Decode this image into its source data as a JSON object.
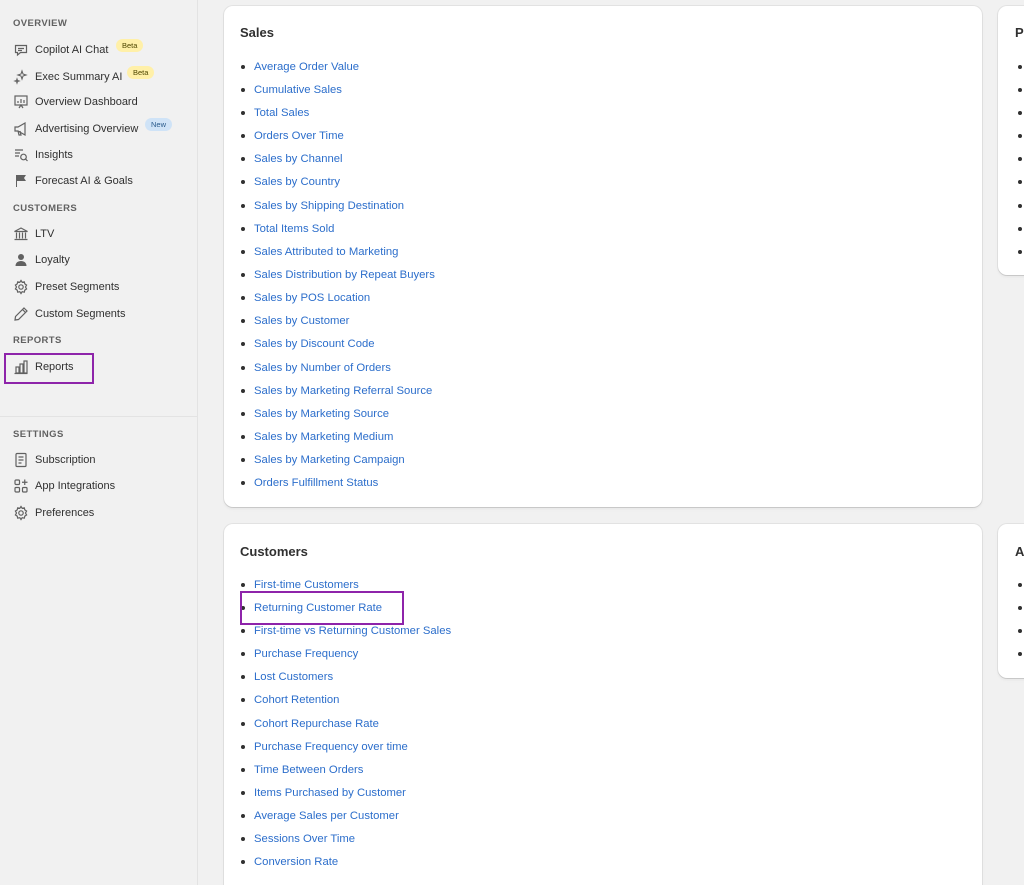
{
  "sidebar": {
    "sections": {
      "overview": "OVERVIEW",
      "customers": "CUSTOMERS",
      "reports": "REPORTS",
      "settings": "SETTINGS"
    },
    "items": {
      "copilot": {
        "label": "Copilot AI Chat",
        "badge": "Beta",
        "icon": "chat-bubble-icon"
      },
      "exec": {
        "label": "Exec Summary AI",
        "badge": "Beta",
        "icon": "sparkle-icon"
      },
      "overview_dashboard": {
        "label": "Overview Dashboard",
        "icon": "dashboard-icon"
      },
      "advertising": {
        "label": "Advertising Overview",
        "badge": "New",
        "icon": "megaphone-icon"
      },
      "insights": {
        "label": "Insights",
        "icon": "search-lines-icon"
      },
      "forecast": {
        "label": "Forecast AI & Goals",
        "icon": "flag-icon"
      },
      "ltv": {
        "label": "LTV",
        "icon": "bank-icon"
      },
      "loyalty": {
        "label": "Loyalty",
        "icon": "person-icon"
      },
      "preset": {
        "label": "Preset Segments",
        "icon": "gear-icon"
      },
      "custom": {
        "label": "Custom Segments",
        "icon": "pencil-icon"
      },
      "reports": {
        "label": "Reports",
        "icon": "bar-chart-icon"
      },
      "subscription": {
        "label": "Subscription",
        "icon": "receipt-icon"
      },
      "integrations": {
        "label": "App Integrations",
        "icon": "apps-icon"
      },
      "preferences": {
        "label": "Preferences",
        "icon": "gear-icon"
      }
    }
  },
  "main": {
    "sales": {
      "title": "Sales",
      "links": [
        "Average Order Value",
        "Cumulative Sales",
        "Total Sales",
        "Orders Over Time",
        "Sales by Channel",
        "Sales by Country",
        "Sales by Shipping Destination",
        "Total Items Sold",
        "Sales Attributed to Marketing",
        "Sales Distribution by Repeat Buyers",
        "Sales by POS Location",
        "Sales by Customer",
        "Sales by Discount Code",
        "Sales by Number of Orders",
        "Sales by Marketing Referral Source",
        "Sales by Marketing Source",
        "Sales by Marketing Medium",
        "Sales by Marketing Campaign",
        "Orders Fulfillment Status"
      ]
    },
    "customers": {
      "title": "Customers",
      "links": [
        "First-time Customers",
        "Returning Customer Rate",
        "First-time vs Returning Customer Sales",
        "Purchase Frequency",
        "Lost Customers",
        "Cohort Retention",
        "Cohort Repurchase Rate",
        "Purchase Frequency over time",
        "Time Between Orders",
        "Items Purchased by Customer",
        "Average Sales per Customer",
        "Sessions Over Time",
        "Conversion Rate"
      ]
    },
    "right_top": {
      "title": "P"
    },
    "right_bottom": {
      "title": "A"
    }
  }
}
